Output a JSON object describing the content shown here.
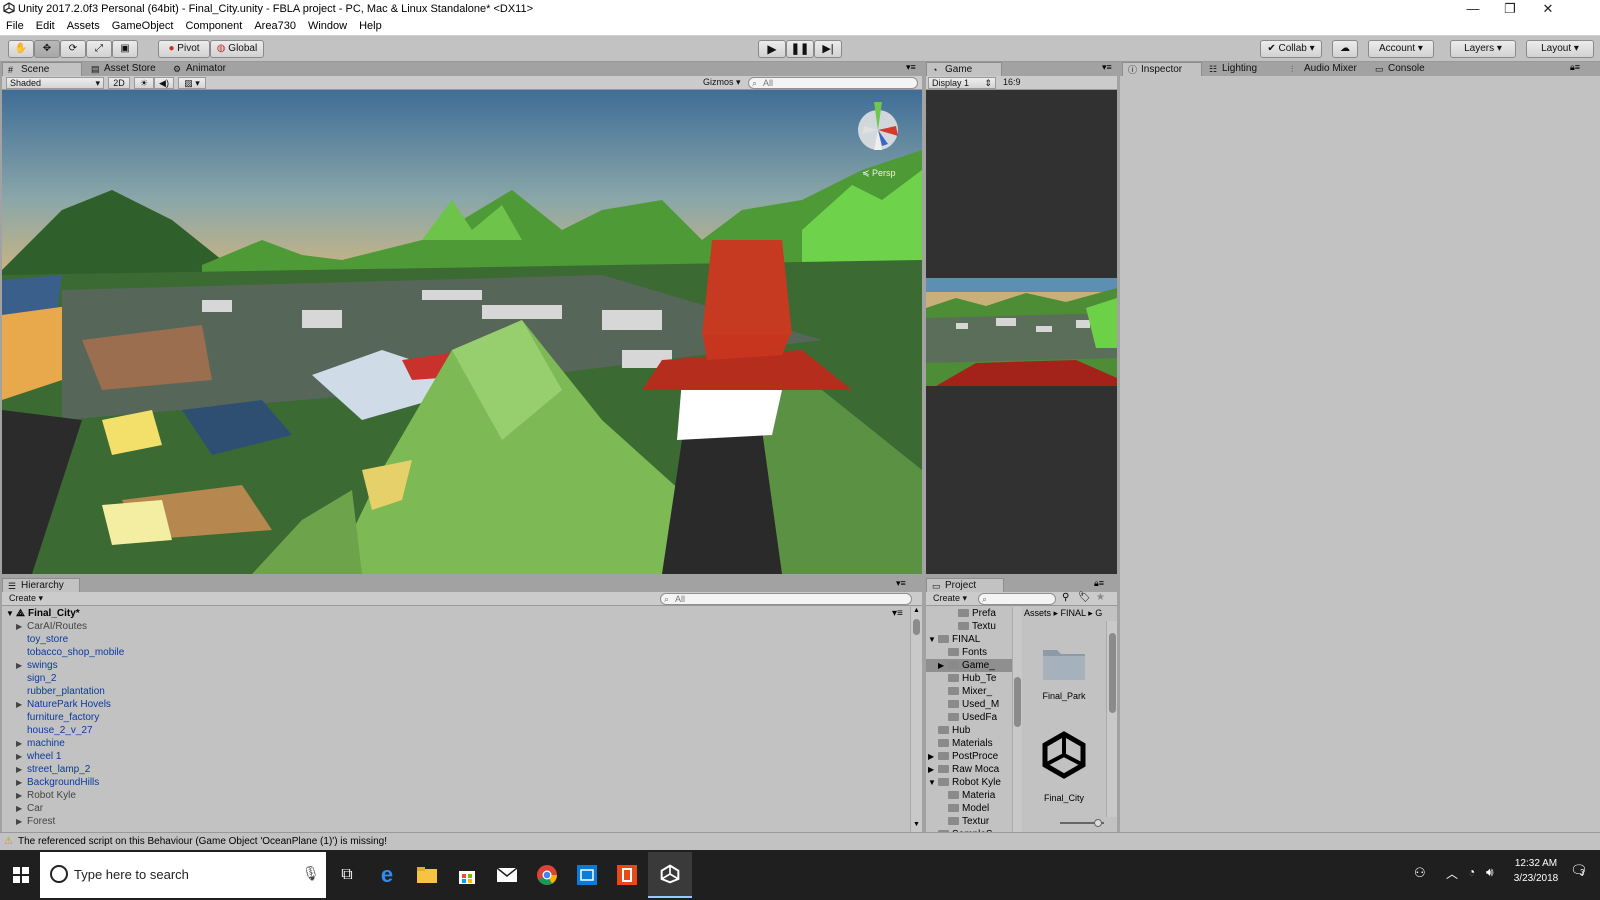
{
  "window": {
    "title": "Unity 2017.2.0f3 Personal (64bit) - Final_City.unity - FBLA project - PC, Mac & Linux Standalone* <DX11>",
    "minimize": "—",
    "restore": "❐",
    "close": "✕"
  },
  "menu": [
    "File",
    "Edit",
    "Assets",
    "GameObject",
    "Component",
    "Area730",
    "Window",
    "Help"
  ],
  "toolbar": {
    "pivot": "Pivot",
    "global": "Global",
    "collab": "Collab",
    "account": "Account",
    "layers": "Layers",
    "layout": "Layout"
  },
  "scene_panel": {
    "tabs": [
      "Scene",
      "Asset Store",
      "Animator"
    ],
    "shading": "Shaded",
    "mode_2d": "2D",
    "gizmos": "Gizmos",
    "search_placeholder": "All",
    "persp_label": "Persp"
  },
  "game_panel": {
    "tab": "Game",
    "display": "Display 1",
    "aspect": "16:9"
  },
  "inspector_panel": {
    "tabs": [
      "Inspector",
      "Lighting",
      "Audio Mixer",
      "Console"
    ]
  },
  "hierarchy": {
    "tab": "Hierarchy",
    "create": "Create",
    "search_placeholder": "All",
    "scene_name": "Final_City*",
    "items": [
      {
        "name": "CarAI/Routes",
        "expandable": true,
        "prefab": false
      },
      {
        "name": "toy_store",
        "expandable": false,
        "prefab": true
      },
      {
        "name": "tobacco_shop_mobile",
        "expandable": false,
        "prefab": true
      },
      {
        "name": "swings",
        "expandable": true,
        "prefab": true
      },
      {
        "name": "sign_2",
        "expandable": false,
        "prefab": true
      },
      {
        "name": "rubber_plantation",
        "expandable": false,
        "prefab": true
      },
      {
        "name": "NaturePark Hovels",
        "expandable": true,
        "prefab": true
      },
      {
        "name": "furniture_factory",
        "expandable": false,
        "prefab": true
      },
      {
        "name": "house_2_v_27",
        "expandable": false,
        "prefab": true
      },
      {
        "name": "machine",
        "expandable": true,
        "prefab": true
      },
      {
        "name": "wheel 1",
        "expandable": true,
        "prefab": true
      },
      {
        "name": "street_lamp_2",
        "expandable": true,
        "prefab": true
      },
      {
        "name": "BackgroundHills",
        "expandable": true,
        "prefab": true
      },
      {
        "name": "Robot Kyle",
        "expandable": true,
        "prefab": false
      },
      {
        "name": "Car",
        "expandable": true,
        "prefab": false
      },
      {
        "name": "Forest",
        "expandable": true,
        "prefab": false
      }
    ]
  },
  "project": {
    "tab": "Project",
    "create": "Create",
    "tree": [
      {
        "name": "Prefa",
        "indent": 3,
        "arrow": ""
      },
      {
        "name": "Textu",
        "indent": 3,
        "arrow": ""
      },
      {
        "name": "FINAL",
        "indent": 1,
        "arrow": "▼"
      },
      {
        "name": "Fonts",
        "indent": 2,
        "arrow": ""
      },
      {
        "name": "Game_",
        "indent": 2,
        "arrow": "▶",
        "selected": true
      },
      {
        "name": "Hub_Te",
        "indent": 2,
        "arrow": ""
      },
      {
        "name": "Mixer_",
        "indent": 2,
        "arrow": ""
      },
      {
        "name": "Used_M",
        "indent": 2,
        "arrow": ""
      },
      {
        "name": "UsedFa",
        "indent": 2,
        "arrow": ""
      },
      {
        "name": "Hub",
        "indent": 1,
        "arrow": ""
      },
      {
        "name": "Materials",
        "indent": 1,
        "arrow": ""
      },
      {
        "name": "PostProce",
        "indent": 1,
        "arrow": "▶"
      },
      {
        "name": "Raw Moca",
        "indent": 1,
        "arrow": "▶"
      },
      {
        "name": "Robot Kyle",
        "indent": 1,
        "arrow": "▼"
      },
      {
        "name": "Materia",
        "indent": 2,
        "arrow": ""
      },
      {
        "name": "Model",
        "indent": 2,
        "arrow": ""
      },
      {
        "name": "Textur",
        "indent": 2,
        "arrow": ""
      },
      {
        "name": "SampleS",
        "indent": 1,
        "arrow": "▶"
      }
    ],
    "breadcrumb": [
      "Assets",
      "FINAL",
      "G"
    ],
    "assets": [
      {
        "name": "Final_Park",
        "type": "folder"
      },
      {
        "name": "Final_City",
        "type": "unity-scene"
      }
    ]
  },
  "status": {
    "message": "The referenced script on this Behaviour (Game Object 'OceanPlane (1)') is missing!"
  },
  "taskbar": {
    "search_placeholder": "Type here to search",
    "time": "12:32 AM",
    "date": "3/23/2018",
    "notification_count": "3"
  }
}
